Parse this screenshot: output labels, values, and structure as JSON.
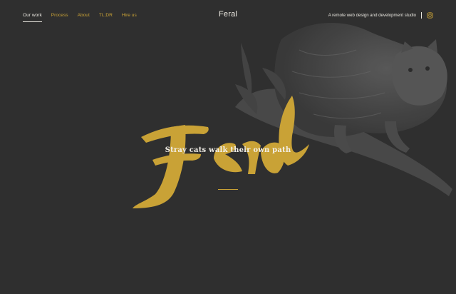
{
  "nav": {
    "items": [
      {
        "label": "Our work",
        "active": true
      },
      {
        "label": "Process",
        "active": false
      },
      {
        "label": "About",
        "active": false
      },
      {
        "label": "TL;DR",
        "active": false
      },
      {
        "label": "Hire us",
        "active": false
      }
    ]
  },
  "brand": {
    "name": "Feral"
  },
  "header": {
    "tagline": "A remote web design and development studio",
    "social_icon": "instagram-icon"
  },
  "hero": {
    "wordmark": "Feral",
    "headline": "Stray cats walk their own path",
    "illustration": "cat-illustration"
  },
  "colors": {
    "background": "#2f2f2f",
    "accent": "#c9a236",
    "text": "#e9e6de"
  }
}
